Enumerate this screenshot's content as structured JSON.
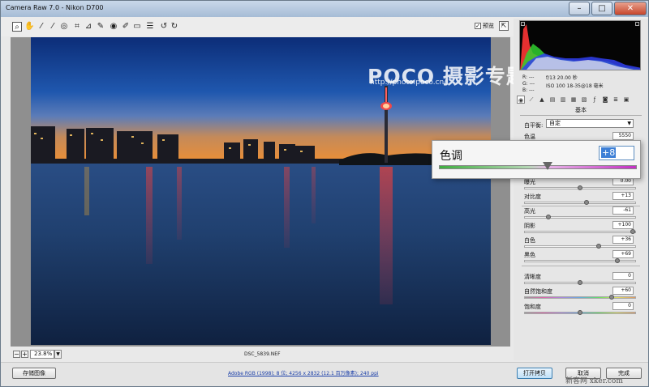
{
  "window": {
    "title": "Camera Raw 7.0 -  Nikon D700",
    "minimize": "–",
    "maximize": "□",
    "close": "✕"
  },
  "toolbar": {
    "tools": [
      "zoom-icon",
      "hand-icon",
      "eyedropper-icon",
      "color-sampler-icon",
      "target-adjust-icon",
      "crop-icon",
      "straighten-icon",
      "spot-removal-icon",
      "red-eye-icon",
      "adjustment-brush-icon",
      "graduated-filter-icon",
      "preferences-icon",
      "rotate-left-icon",
      "rotate-right-icon"
    ],
    "preview_label": "预览",
    "preview_checked": true
  },
  "watermark": {
    "logo": "POCO 摄影专题",
    "url": "http://photo.poco.cn/"
  },
  "canvas": {
    "zoom_value": "23.8%",
    "filename": "DSC_5839.NEF"
  },
  "info": {
    "r": "R:  ---",
    "g": "G:  ---",
    "b": "B:  ---",
    "exposure": "f/13   20.00 秒",
    "lens": "ISO 100   18-35@18 毫米"
  },
  "panel": {
    "section_title": "基本",
    "wb_label": "白平衡:",
    "wb_value": "自定",
    "sliders": [
      {
        "label": "色温",
        "value": "5550",
        "pos": 0.52
      },
      {
        "label": "曝光",
        "value": "0.00",
        "pos": 0.5
      },
      {
        "label": "对比度",
        "value": "+13",
        "pos": 0.56
      },
      {
        "label": "高光",
        "value": "-61",
        "pos": 0.2
      },
      {
        "label": "阴影",
        "value": "+100",
        "pos": 1.0
      },
      {
        "label": "白色",
        "value": "+36",
        "pos": 0.68
      },
      {
        "label": "黑色",
        "value": "+69",
        "pos": 0.85
      },
      {
        "label": "清晰度",
        "value": "0",
        "pos": 0.5
      },
      {
        "label": "自然饱和度",
        "value": "+60",
        "pos": 0.8
      },
      {
        "label": "饱和度",
        "value": "0",
        "pos": 0.5
      }
    ]
  },
  "popover": {
    "label": "色调",
    "value": "+8",
    "pos": 0.55
  },
  "bottom": {
    "save_label": "存储图像",
    "workflow": "Adobe RGB (1998); 8 位; 4256 x 2832 (12.1 百万像素); 240 ppi",
    "open_copy_label": "打开拷贝",
    "cancel_label": "取消",
    "done_label": "完成",
    "site_watermark": "新客网  xker.com"
  }
}
